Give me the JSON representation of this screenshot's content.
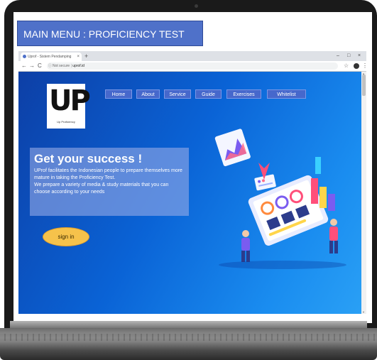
{
  "slide": {
    "title": "MAIN MENU : PROFICIENCY TEST"
  },
  "browser": {
    "tab_title": "Uprof - Sistem Pendamping",
    "tab_close": "×",
    "new_tab": "+",
    "window_controls": {
      "minimize": "–",
      "maximize": "□",
      "close": "×"
    },
    "nav": {
      "back": "←",
      "forward": "→",
      "reload": "C"
    },
    "url_security": "Not secure",
    "url_separator": "|",
    "url": "uprof.id"
  },
  "site": {
    "logo": {
      "mark": "UP",
      "subtitle": "Up Proficiency"
    },
    "nav_items": [
      {
        "label": "Home"
      },
      {
        "label": "About"
      },
      {
        "label": "Service"
      },
      {
        "label": "Guide"
      },
      {
        "label": "Exercises"
      },
      {
        "label": "Whitelist"
      }
    ],
    "hero": {
      "title": "Get your success !",
      "line1": "UProf facilitates the Indonesian people to prepare themselves more mature in taking the Proficiency Test.",
      "line2": "We prepare a variety of media & study materials that you can choose according to your needs"
    },
    "signin_label": "sign in"
  },
  "colors": {
    "slide_title_bg": "#4f71c9",
    "page_gradient_start": "#0d3fa6",
    "page_gradient_end": "#2aa0f5",
    "nav_item_bg": "#4668cc",
    "signin_bg": "#f6c24b"
  }
}
